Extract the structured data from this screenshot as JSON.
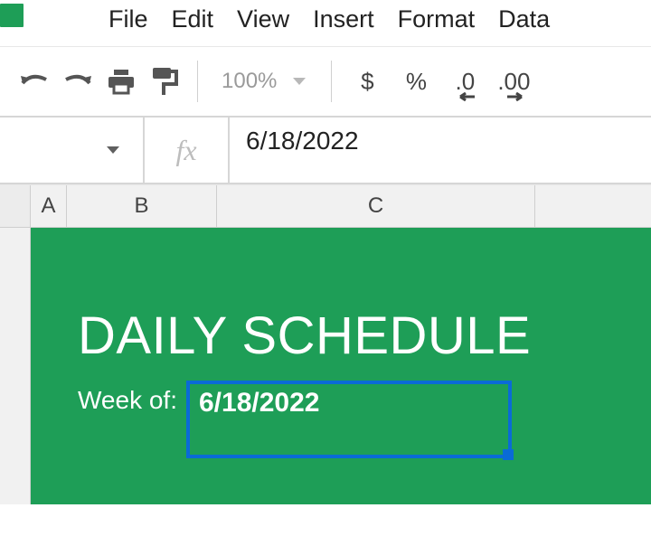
{
  "menu": {
    "file": "File",
    "edit": "Edit",
    "view": "View",
    "insert": "Insert",
    "format": "Format",
    "data": "Data"
  },
  "toolbar": {
    "zoom_value": "100%",
    "currency_symbol": "$",
    "percent_symbol": "%",
    "decrease_decimal": ".0",
    "increase_decimal": ".00"
  },
  "formula_bar": {
    "fx_label": "fx",
    "formula_value": "6/18/2022"
  },
  "columns": {
    "A": "A",
    "B": "B",
    "C": "C"
  },
  "sheet": {
    "title": "DAILY SCHEDULE",
    "weekof_label": "Week of:",
    "weekof_value": "6/18/2022"
  }
}
